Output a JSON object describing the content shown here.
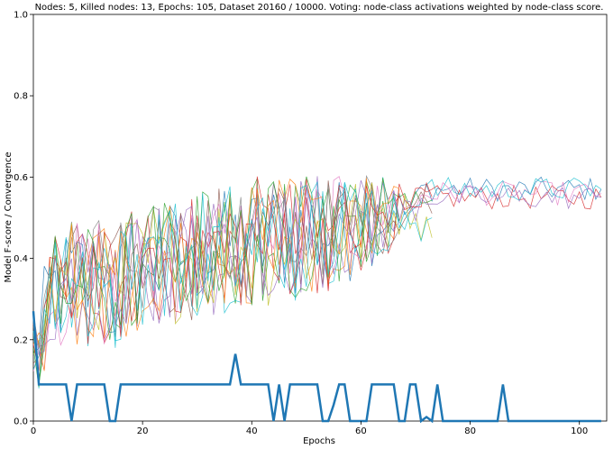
{
  "chart_data": {
    "type": "line",
    "title": "Nodes: 5, Killed nodes: 13, Epochs: 105, Dataset 20160 / 10000.  Voting: node-class activations weighted by node-class score.",
    "xlabel": "Epochs",
    "ylabel": "Model F-score / Convergence",
    "xlim": [
      0,
      105
    ],
    "ylim": [
      0,
      1.0
    ],
    "x_ticks": [
      "0",
      "20",
      "40",
      "60",
      "80",
      "100"
    ],
    "y_ticks": [
      "0.0",
      "0.2",
      "0.4",
      "0.6",
      "0.8",
      "1.0"
    ],
    "grid": false,
    "legend": "none",
    "series": [
      {
        "color": "#1f77b4",
        "role": "convergence",
        "x": [
          0,
          1,
          2,
          3,
          4,
          5,
          6,
          7,
          8,
          9,
          10,
          11,
          12,
          13,
          14,
          15,
          16,
          17,
          18,
          19,
          20,
          21,
          22,
          23,
          24,
          25,
          26,
          27,
          28,
          29,
          30,
          31,
          32,
          33,
          34,
          35,
          36,
          37,
          38,
          39,
          40,
          41,
          42,
          43,
          44,
          45,
          46,
          47,
          48,
          49,
          50,
          51,
          52,
          53,
          54,
          55,
          56,
          57,
          58,
          59,
          60,
          61,
          62,
          63,
          64,
          65,
          66,
          67,
          68,
          69,
          70,
          71,
          72,
          73,
          74,
          75,
          76,
          77,
          78,
          79,
          80,
          81,
          82,
          83,
          84,
          85,
          86,
          87,
          88,
          89,
          90,
          91,
          92,
          93,
          94,
          95,
          96,
          97,
          98,
          99,
          100,
          101,
          102,
          103,
          104
        ],
        "values": [
          0.27,
          0.09,
          0.09,
          0.09,
          0.09,
          0.09,
          0.09,
          0.0,
          0.09,
          0.09,
          0.09,
          0.09,
          0.09,
          0.09,
          0.0,
          0.0,
          0.09,
          0.09,
          0.09,
          0.09,
          0.09,
          0.09,
          0.09,
          0.09,
          0.09,
          0.09,
          0.09,
          0.09,
          0.09,
          0.09,
          0.09,
          0.09,
          0.09,
          0.09,
          0.09,
          0.09,
          0.09,
          0.165,
          0.09,
          0.09,
          0.09,
          0.09,
          0.09,
          0.09,
          0.0,
          0.09,
          0.0,
          0.09,
          0.09,
          0.09,
          0.09,
          0.09,
          0.09,
          0.0,
          0.0,
          0.04,
          0.09,
          0.09,
          0.0,
          0.0,
          0.0,
          0.0,
          0.09,
          0.09,
          0.09,
          0.09,
          0.09,
          0.0,
          0.0,
          0.09,
          0.09,
          0.0,
          0.01,
          0.0,
          0.09,
          0.0,
          0.0,
          0.0,
          0.0,
          0.0,
          0.0,
          0.0,
          0.0,
          0.0,
          0.0,
          0.0,
          0.09,
          0.0,
          0.0,
          0.0,
          0.0,
          0.0,
          0.0,
          0.0,
          0.0,
          0.0,
          0.0,
          0.0,
          0.0,
          0.0,
          0.0,
          0.0,
          0.0,
          0.0,
          0.0
        ]
      }
    ],
    "fscore_series": {
      "colors": [
        "#1f77b4",
        "#ff7f0e",
        "#2ca02c",
        "#d62728",
        "#9467bd",
        "#8c564b",
        "#e377c2",
        "#7f7f7f",
        "#bcbd22",
        "#17becf",
        "#ff7f0e",
        "#d62728",
        "#9467bd",
        "#2ca02c",
        "#17becf"
      ],
      "note": "15 thin colored F-score series over epochs 0-104; values estimated from figure",
      "mean": [
        0.22,
        0.15,
        0.25,
        0.3,
        0.32,
        0.31,
        0.33,
        0.35,
        0.34,
        0.36,
        0.33,
        0.35,
        0.37,
        0.32,
        0.3,
        0.31,
        0.34,
        0.36,
        0.38,
        0.37,
        0.39,
        0.38,
        0.4,
        0.39,
        0.41,
        0.4,
        0.39,
        0.41,
        0.42,
        0.4,
        0.41,
        0.43,
        0.42,
        0.41,
        0.43,
        0.42,
        0.44,
        0.43,
        0.42,
        0.44,
        0.43,
        0.45,
        0.44,
        0.43,
        0.45,
        0.44,
        0.46,
        0.45,
        0.44,
        0.46,
        0.45,
        0.47,
        0.46,
        0.47,
        0.46,
        0.48,
        0.47,
        0.48,
        0.47,
        0.49,
        0.48,
        0.5,
        0.49,
        0.5,
        0.51,
        0.5,
        0.51,
        0.52,
        0.51,
        0.52,
        0.53,
        0.52,
        0.53,
        0.53,
        0.54,
        0.53,
        0.54,
        0.54,
        0.55,
        0.54,
        0.55,
        0.55,
        0.55,
        0.54,
        0.55,
        0.55,
        0.56,
        0.55,
        0.55,
        0.56,
        0.55,
        0.56,
        0.55,
        0.56,
        0.56,
        0.55,
        0.56,
        0.56,
        0.55,
        0.56,
        0.56,
        0.55,
        0.56,
        0.56,
        0.55
      ],
      "spread": [
        0.12,
        0.1,
        0.12,
        0.13,
        0.13,
        0.13,
        0.14,
        0.14,
        0.14,
        0.14,
        0.14,
        0.14,
        0.14,
        0.14,
        0.14,
        0.14,
        0.14,
        0.14,
        0.14,
        0.14,
        0.14,
        0.14,
        0.14,
        0.14,
        0.14,
        0.14,
        0.14,
        0.14,
        0.14,
        0.14,
        0.14,
        0.14,
        0.14,
        0.14,
        0.14,
        0.14,
        0.14,
        0.14,
        0.14,
        0.14,
        0.14,
        0.14,
        0.14,
        0.14,
        0.14,
        0.14,
        0.14,
        0.14,
        0.14,
        0.14,
        0.14,
        0.14,
        0.14,
        0.13,
        0.13,
        0.13,
        0.12,
        0.12,
        0.12,
        0.11,
        0.11,
        0.1,
        0.1,
        0.09,
        0.09,
        0.08,
        0.07,
        0.06,
        0.05,
        0.05,
        0.04,
        0.04,
        0.03,
        0.03,
        0.03,
        0.03,
        0.03,
        0.03,
        0.03,
        0.03,
        0.03,
        0.03,
        0.03,
        0.03,
        0.03,
        0.03,
        0.03,
        0.03,
        0.03,
        0.03,
        0.03,
        0.03,
        0.03,
        0.03,
        0.03,
        0.03,
        0.03,
        0.03,
        0.03,
        0.03,
        0.03,
        0.03,
        0.03,
        0.03,
        0.03
      ],
      "final_values": [
        0.57,
        0.54,
        0.56,
        0.55,
        0.57,
        0.54,
        0.56,
        0.55,
        0.48,
        0.57,
        0.54,
        0.56,
        0.55,
        0.56,
        0.48
      ]
    }
  }
}
